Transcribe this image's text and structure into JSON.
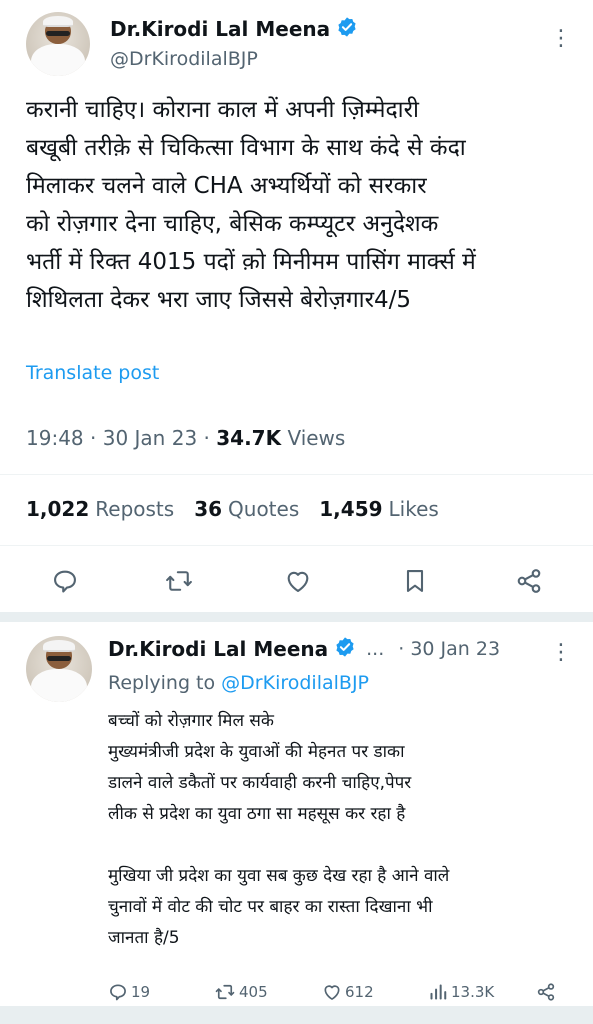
{
  "main_tweet": {
    "author_name": "Dr.Kirodi Lal Meena",
    "handle": "@DrKirodilalBJP",
    "more_glyph": "⋮",
    "text": "करानी चाहिए। कोराना काल में अपनी ज़िम्मेदारी\nबखूबी तरीक़े से चिकित्सा विभाग के साथ कंदे से कंदा\nमिलाकर चलने वाले CHA अभ्यर्थियों को सरकार\nको रोज़गार देना चाहिए, बेसिक कम्प्यूटर अनुदेशक\nभर्ती में रिक्त 4015 पदों क़ो मिनीमम पासिंग मार्क्स में\nशिथिलता देकर भरा जाए जिससे बेरोज़गार4/5",
    "translate_label": "Translate post",
    "time": "19:48",
    "date": "30 Jan 23",
    "views_count": "34.7K",
    "views_label": "Views",
    "reposts_count": "1,022",
    "reposts_label": "Reposts",
    "quotes_count": "36",
    "quotes_label": "Quotes",
    "likes_count": "1,459",
    "likes_label": "Likes"
  },
  "reply_tweet": {
    "author_name": "Dr.Kirodi Lal Meena",
    "name_suffix": "...",
    "date": "· 30 Jan 23",
    "more_glyph": "⋮",
    "replying_prefix": "Replying to",
    "replying_handle": "@DrKirodilalBJP",
    "text": "बच्चों को रोज़गार मिल सके\nमुख्यमंत्रीजी प्रदेश के युवाओं की मेहनत पर डाका\nडालने वाले डकैतों पर कार्यवाही करनी चाहिए,पेपर\nलीक से प्रदेश का युवा ठगा सा महसूस कर रहा है\n\nमुखिया जी प्रदेश का युवा सब कुछ देख रहा है आने वाले\nचुनावों में वोट की चोट पर बाहर का रास्ता दिखाना भी\nजानता है/5",
    "replies_count": "19",
    "reposts_count": "405",
    "likes_count": "612",
    "views_count": "13.3K"
  },
  "colors": {
    "accent": "#1d9bf0",
    "secondary_text": "#536471",
    "primary_text": "#0f1419",
    "verified": "#1d9bf0"
  },
  "icons": [
    "verified-badge-icon",
    "more-options-icon",
    "reply-icon",
    "repost-icon",
    "like-icon",
    "bookmark-icon",
    "share-icon",
    "views-icon"
  ]
}
